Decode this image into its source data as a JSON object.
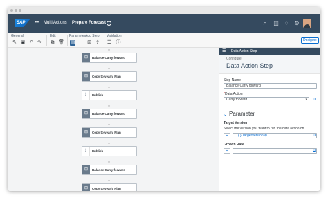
{
  "shell": {
    "app_name": "Multi Actions",
    "tab_title": "Prepare Forecast"
  },
  "toolbar": {
    "groups": {
      "general": "General",
      "edit": "Edit",
      "parameter": "Parameter",
      "add_step": "Add Step",
      "validation": "Validation"
    },
    "designer_label": "Designer"
  },
  "flow": {
    "steps": [
      {
        "label": "Balance Carry forward",
        "icon": "data-action-icon",
        "type": "data-action"
      },
      {
        "label": "Copy to yearly Plan",
        "icon": "data-action-icon",
        "type": "data-action"
      },
      {
        "label": "Publish",
        "icon": "publish-icon",
        "type": "publish"
      },
      {
        "label": "Balance Carry forward",
        "icon": "data-action-icon",
        "type": "data-action"
      },
      {
        "label": "Copy to yearly Plan",
        "icon": "data-action-icon",
        "type": "data-action"
      },
      {
        "label": "Publish",
        "icon": "publish-icon",
        "type": "publish"
      },
      {
        "label": "Balance Carry forward",
        "icon": "data-action-icon",
        "type": "data-action"
      },
      {
        "label": "Copy to yearly Plan",
        "icon": "data-action-icon",
        "type": "data-action"
      }
    ]
  },
  "panel": {
    "header": "Data Action Step",
    "configure": "Configure",
    "title": "Data Action Step",
    "step_name_label": "Step Name",
    "step_name_value": "Balance Carry forward",
    "data_action_label": "Data Action",
    "data_action_required": "*",
    "data_action_value": "Carry forward",
    "parameter_heading": "Parameter",
    "target_version_label": "Target Version",
    "target_version_help": "Select the version you want to run the data action on",
    "target_version_token": "TargetVersion",
    "growth_rate_label": "Growth Rate"
  },
  "colors": {
    "shell": "#354a5f",
    "accent": "#0a6ed1",
    "canvas": "#f3f4f5"
  }
}
